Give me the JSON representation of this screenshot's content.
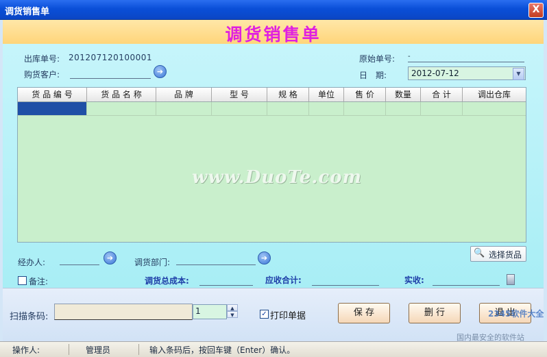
{
  "window": {
    "title": "调货销售单",
    "close_glyph": "X"
  },
  "header": {
    "title": "调货销售单"
  },
  "form": {
    "out_no_label": "出库单号:",
    "out_no_value": "201207120100001",
    "customer_label": "购货客户:",
    "customer_value": "",
    "orig_no_label": "原始单号:",
    "orig_no_value": "-",
    "date_label": "日　期:",
    "date_value": "2012-07-12"
  },
  "grid": {
    "columns": [
      "货 品 编 号",
      "货 品 名 称",
      "品  牌",
      "型 号",
      "规 格",
      "单位",
      "售 价",
      "数量",
      "合 计",
      "调出仓库"
    ],
    "rows": [
      [
        "",
        "",
        "",
        "",
        "",
        "",
        "",
        "",
        "",
        ""
      ]
    ]
  },
  "watermark": "www.DuoTe.com",
  "lower_form": {
    "handler_label": "经办人:",
    "handler_value": "",
    "dept_label": "调货部门:",
    "dept_value": "",
    "select_goods_label": "选择货品",
    "remark_label": "备注:",
    "total_cost_label": "调货总成本:",
    "total_cost_value": "",
    "receivable_label": "应收合计:",
    "receivable_value": "",
    "received_label": "实收:",
    "received_value": ""
  },
  "bottom": {
    "barcode_label": "扫描条码:",
    "barcode_value": "",
    "quantity_value": "1",
    "print_label": "打印单据",
    "print_checked": "✓",
    "save_label": "保 存",
    "delete_row_label": "删 行",
    "exit_label": "退 出"
  },
  "status": {
    "operator_label": "操作人:",
    "operator_value": "管理员",
    "hint": "输入条码后，按回车键（Enter）确认。"
  },
  "branding": {
    "site": "2345软件大全",
    "slogan": "国内最安全的软件站"
  },
  "colors": {
    "title_accent": "#e020e0",
    "panel_bg": "#b6f1f8",
    "grid_bg": "#c9efcc",
    "selected_cell": "#1f4fa6"
  }
}
